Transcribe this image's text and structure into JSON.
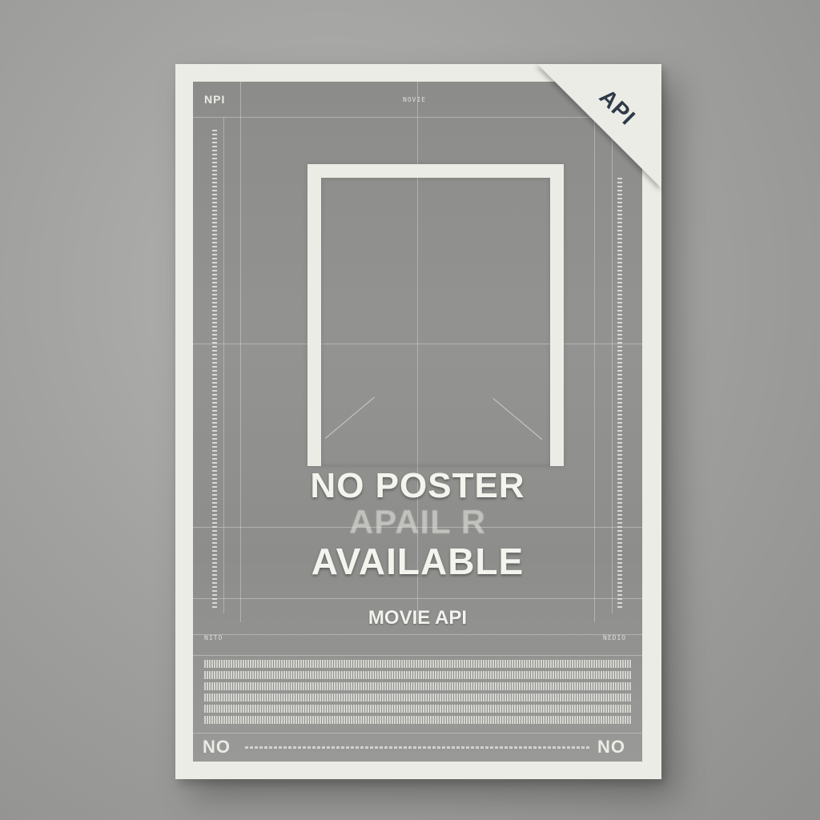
{
  "poster": {
    "headline_line1": "NO POSTER",
    "ghost_line": "APAIL    R",
    "headline_line2": "AVAILABLE",
    "subtitle": "MOVIE API",
    "top_left_mark": "NPI",
    "top_center_mark": "NOVIE",
    "corner_badge": "API",
    "bottom_left": "NO",
    "bottom_right": "NO",
    "footer_left_tag": "NITO",
    "footer_right_tag": "NEDIO"
  },
  "colors": {
    "background": "#a2a2a0",
    "poster_border": "#ecece6",
    "poster_inner": "#8f8f8d",
    "badge_text": "#2f3a48"
  }
}
